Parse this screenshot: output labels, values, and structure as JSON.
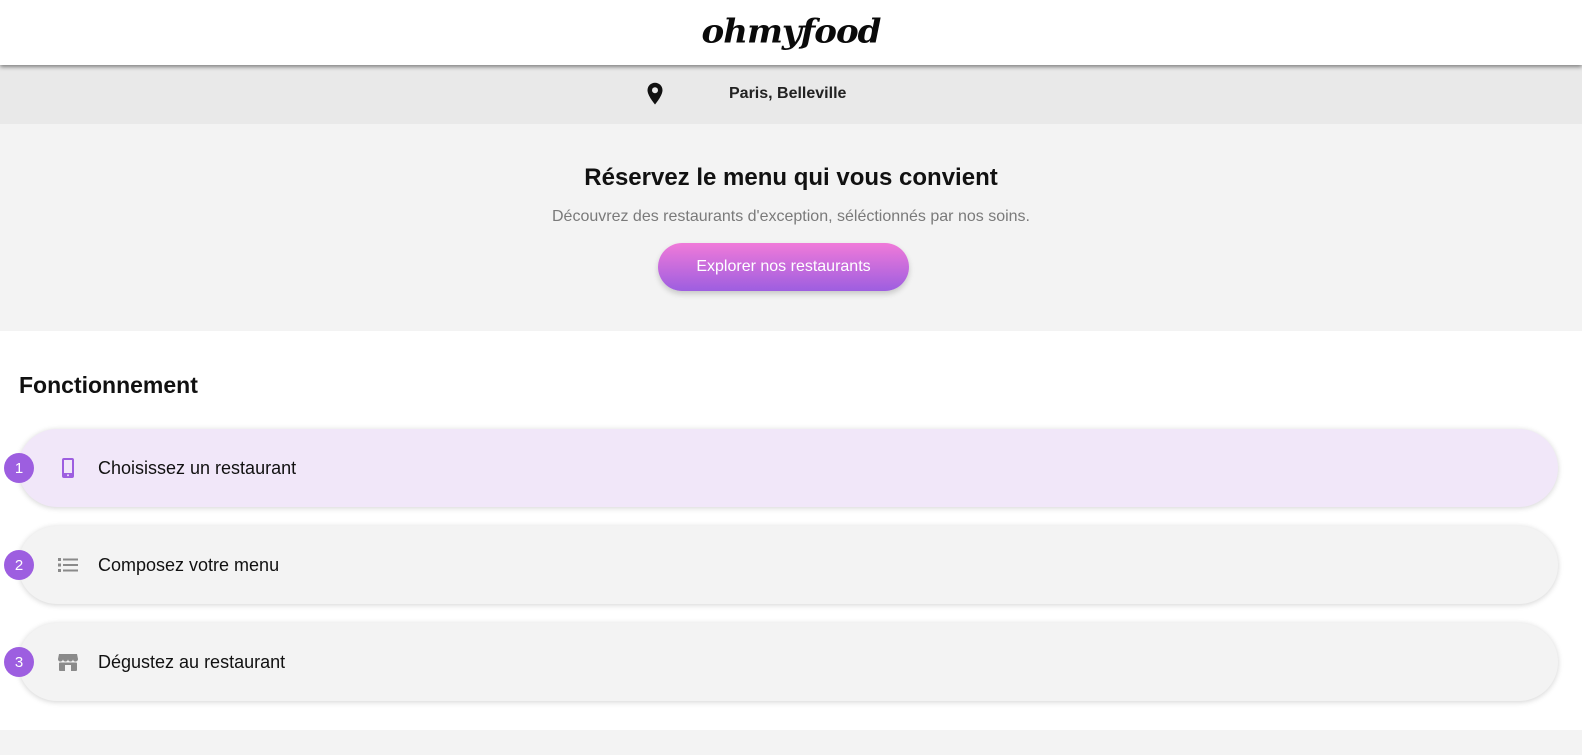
{
  "header": {
    "logo_text": "ohmyfood"
  },
  "location": {
    "icon": "map-pin-icon",
    "text": "Paris, Belleville"
  },
  "hero": {
    "title": "Réservez le menu qui vous convient",
    "subtitle": "Découvrez des restaurants d'exception, séléctionnés par nos soins.",
    "cta_label": "Explorer nos restaurants"
  },
  "how_it_works": {
    "title": "Fonctionnement",
    "steps": [
      {
        "number": "1",
        "icon": "smartphone-icon",
        "label": "Choisissez un restaurant",
        "active": true
      },
      {
        "number": "2",
        "icon": "list-icon",
        "label": "Composez votre menu",
        "active": false
      },
      {
        "number": "3",
        "icon": "store-icon",
        "label": "Dégustez au restaurant",
        "active": false
      }
    ]
  },
  "colors": {
    "accent": "#9d5ee0",
    "gradient_start": "#f07ad9",
    "gradient_end": "#9d5ee0",
    "active_step_bg": "#f1e7f9"
  }
}
